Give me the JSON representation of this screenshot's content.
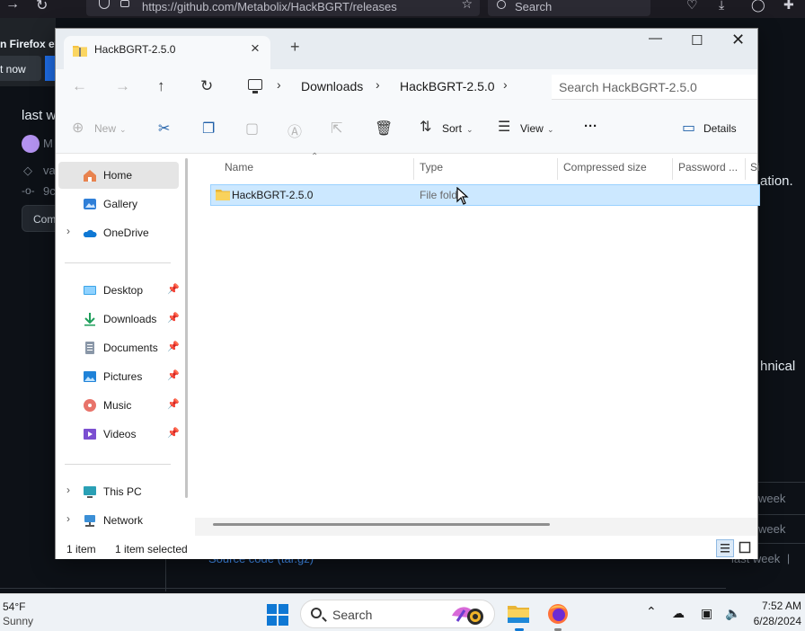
{
  "browser": {
    "url": "https://github.com/Metabolix/HackBGRT/releases",
    "search_placeholder": "Search"
  },
  "github_background": {
    "banner_text": "n Firefox ev",
    "banner_button": "t now",
    "heading_partial": "last w",
    "user_partial": "M",
    "tag_partial": "va",
    "commit_partial": "9c",
    "compare_button": "Com",
    "right_text_1": "ation.",
    "right_text_2": "hnical",
    "asset_rows": [
      "week",
      "week",
      "last week"
    ],
    "source_code_label": "Source code (tar.gz)"
  },
  "explorer": {
    "tab_title": "HackBGRT-2.5.0",
    "new_tab_label": "+",
    "breadcrumb": [
      "Downloads",
      "HackBGRT-2.5.0"
    ],
    "search_placeholder": "Search HackBGRT-2.5.0",
    "commands": {
      "new": "New",
      "sort": "Sort",
      "view": "View",
      "more": "···",
      "details": "Details"
    },
    "nav_items": [
      {
        "label": "Home",
        "icon": "home-icon",
        "selected": true
      },
      {
        "label": "Gallery",
        "icon": "gallery-icon"
      },
      {
        "label": "OneDrive",
        "icon": "cloud-icon",
        "expandable": true
      },
      {
        "label": "Desktop",
        "icon": "desktop-icon",
        "pinned": true
      },
      {
        "label": "Downloads",
        "icon": "download-icon",
        "pinned": true
      },
      {
        "label": "Documents",
        "icon": "document-icon",
        "pinned": true
      },
      {
        "label": "Pictures",
        "icon": "pictures-icon",
        "pinned": true
      },
      {
        "label": "Music",
        "icon": "music-icon",
        "pinned": true
      },
      {
        "label": "Videos",
        "icon": "video-icon",
        "pinned": true
      },
      {
        "label": "This PC",
        "icon": "pc-icon",
        "expandable": true
      },
      {
        "label": "Network",
        "icon": "network-icon",
        "expandable": true
      }
    ],
    "columns": [
      "Name",
      "Type",
      "Compressed size",
      "Password ...",
      "Si"
    ],
    "files": [
      {
        "name": "HackBGRT-2.5.0",
        "type": "File fold",
        "selected": true
      }
    ],
    "status": {
      "count": "1 item",
      "selection": "1 item selected"
    }
  },
  "taskbar": {
    "weather_temp": "54°F",
    "weather_condition": "Sunny",
    "search_placeholder": "Search",
    "time": "7:52 AM",
    "date": "6/28/2024"
  },
  "colors": {
    "accent": "#0f78d4",
    "selection": "#cce8ff",
    "selection_border": "#99d1ff",
    "folder": "#f6c343",
    "github_bg": "#0d1117"
  }
}
